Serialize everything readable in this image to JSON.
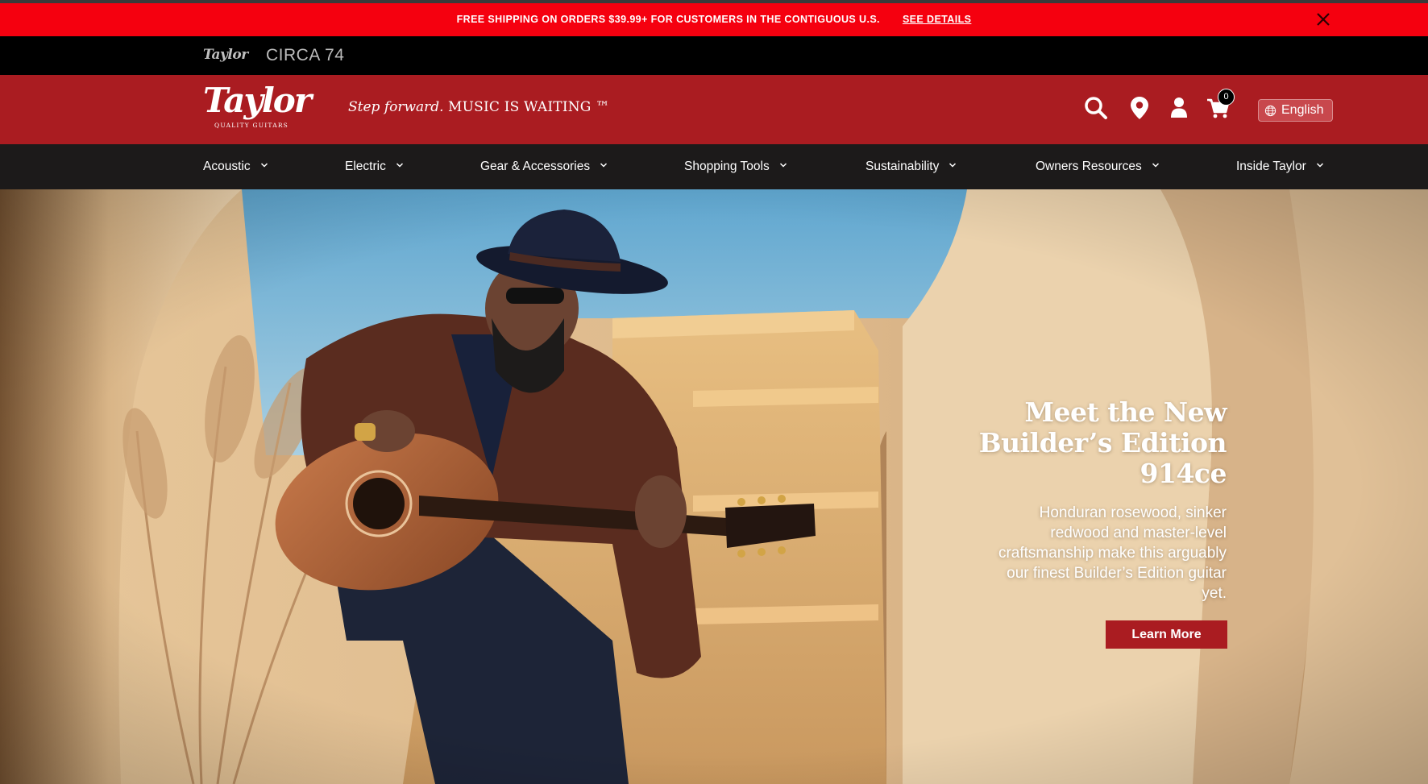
{
  "promo": {
    "message": "FREE SHIPPING ON ORDERS $39.99+ FOR CUSTOMERS IN THE CONTIGUOUS U.S.",
    "link_label": "SEE DETAILS",
    "close_icon": "close-icon"
  },
  "subbar": {
    "brand_logo_text": "Taylor",
    "circa_label": "CIRCA 74"
  },
  "header": {
    "logo_word": "Taylor",
    "logo_sub": "QUALITY GUITARS",
    "tagline_italic": "Step forward.",
    "tagline_main": "MUSIC IS WAITING ™",
    "icons": [
      "search-icon",
      "location-pin-icon",
      "user-icon",
      "cart-icon"
    ],
    "cart_count": "0",
    "language_label": "English"
  },
  "nav": {
    "items": [
      {
        "label": "Acoustic"
      },
      {
        "label": "Electric"
      },
      {
        "label": "Gear & Accessories"
      },
      {
        "label": "Shopping Tools"
      },
      {
        "label": "Sustainability"
      },
      {
        "label": "Owners Resources"
      },
      {
        "label": "Inside Taylor"
      }
    ]
  },
  "hero": {
    "title_line1": "Meet the New",
    "title_line2": "Builder’s Edition",
    "title_line3": "914ce",
    "body_line1": "Honduran rosewood, sinker",
    "body_line2": "redwood and master-level",
    "body_line3": "craftsmanship make this arguably",
    "body_line4": "our finest Builder’s Edition guitar",
    "body_line5": "yet.",
    "cta_label": "Learn More"
  },
  "colors": {
    "promo_red": "#f5000f",
    "brand_red": "#aa1c21",
    "nav_dark": "#1c1a1a"
  }
}
